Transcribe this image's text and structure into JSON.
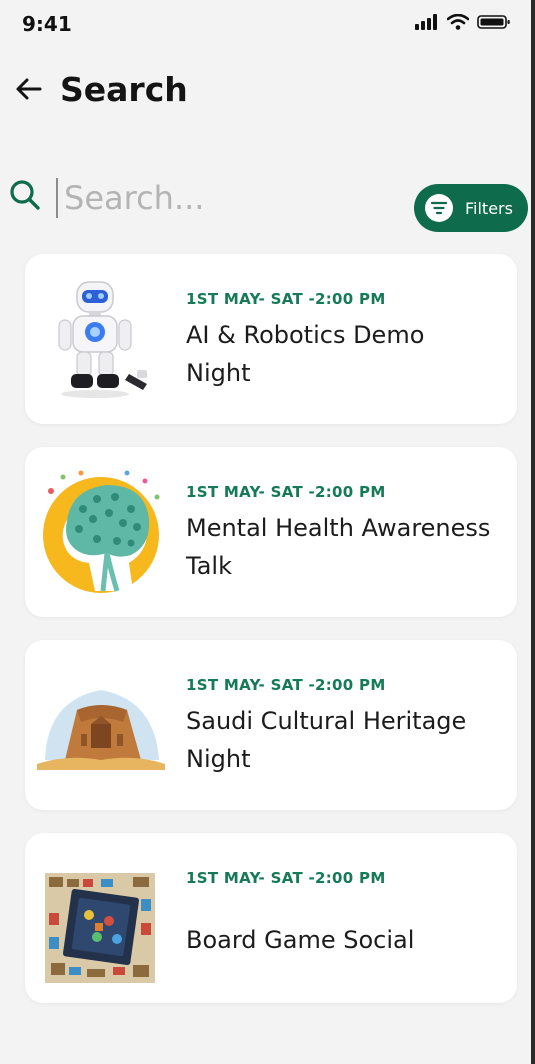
{
  "status_bar": {
    "time": "9:41",
    "icons": [
      "signal-icon",
      "wifi-icon",
      "battery-icon"
    ]
  },
  "header": {
    "back_icon": "arrow-left-icon",
    "title": "Search"
  },
  "search": {
    "icon": "search-icon",
    "placeholder": "Search...",
    "value": ""
  },
  "filters": {
    "label": "Filters",
    "icon": "filter-icon"
  },
  "colors": {
    "accent": "#0e6b4b",
    "date_text": "#157a55",
    "background": "#f3f3f3",
    "card": "#ffffff"
  },
  "events": [
    {
      "date": "1ST  MAY- SAT -2:00 PM",
      "title": "AI & Robotics Demo Night",
      "image": "robot-image"
    },
    {
      "date": "1ST  MAY- SAT -2:00 PM",
      "title": "Mental Health Awareness Talk",
      "image": "brain-tree-image"
    },
    {
      "date": "1ST  MAY- SAT -2:00 PM",
      "title": "Saudi Cultural Heritage Night",
      "image": "heritage-site-image"
    },
    {
      "date": "1ST  MAY- SAT -2:00 PM",
      "title": "Board Game Social",
      "image": "board-game-image"
    }
  ]
}
